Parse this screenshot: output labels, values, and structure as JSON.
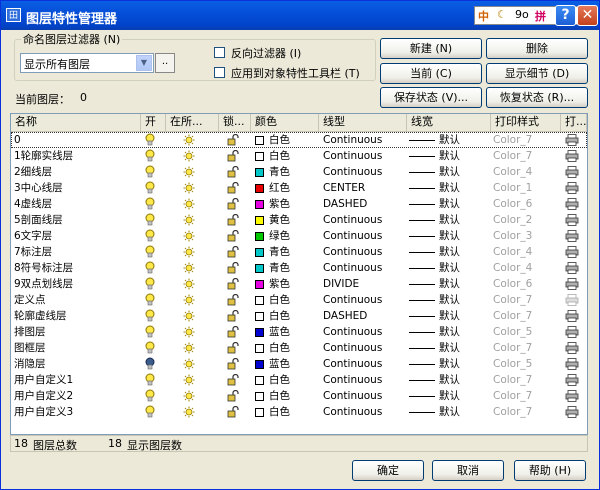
{
  "window": {
    "title": "图层特性管理器",
    "icon_label": "田",
    "ime": {
      "lang": "中",
      "items": [
        "☾",
        "9o",
        "拼"
      ]
    },
    "help_label": "?",
    "close_label": "✕"
  },
  "filter": {
    "legend": "命名图层过滤器 (N)",
    "selected": "显示所有图层",
    "dots_label": "..",
    "invert_label": "反向过滤器 (I)",
    "apply_label": "应用到对象特性工具栏 (T)"
  },
  "buttons": {
    "new": "新建 (N)",
    "delete": "删除",
    "current": "当前 (C)",
    "show_details": "显示细节 (D)",
    "save_state": "保存状态 (V)...",
    "restore_state": "恢复状态 (R)...",
    "ok": "确定",
    "cancel": "取消",
    "help": "帮助 (H)"
  },
  "current_layer": {
    "label": "当前图层：",
    "value": "0"
  },
  "columns": [
    "名称",
    "开",
    "在所...",
    "锁...",
    "颜色",
    "线型",
    "线宽",
    "打印样式",
    "打..."
  ],
  "layers": [
    {
      "name": "0",
      "on": true,
      "color_name": "白色",
      "color_hex": "#ffffff",
      "linetype": "Continuous",
      "lineweight": "默认",
      "plot_style": "Color_7",
      "selected": true
    },
    {
      "name": "1轮廓实线层",
      "on": true,
      "color_name": "白色",
      "color_hex": "#ffffff",
      "linetype": "Continuous",
      "lineweight": "默认",
      "plot_style": "Color_7"
    },
    {
      "name": "2细线层",
      "on": true,
      "color_name": "青色",
      "color_hex": "#00c8c8",
      "linetype": "Continuous",
      "lineweight": "默认",
      "plot_style": "Color_4"
    },
    {
      "name": "3中心线层",
      "on": true,
      "color_name": "红色",
      "color_hex": "#e60000",
      "linetype": "CENTER",
      "lineweight": "默认",
      "plot_style": "Color_1"
    },
    {
      "name": "4虚线层",
      "on": true,
      "color_name": "紫色",
      "color_hex": "#e600e6",
      "linetype": "DASHED",
      "lineweight": "默认",
      "plot_style": "Color_6"
    },
    {
      "name": "5剖面线层",
      "on": true,
      "color_name": "黄色",
      "color_hex": "#ffff00",
      "linetype": "Continuous",
      "lineweight": "默认",
      "plot_style": "Color_2"
    },
    {
      "name": "6文字层",
      "on": true,
      "color_name": "绿色",
      "color_hex": "#00c800",
      "linetype": "Continuous",
      "lineweight": "默认",
      "plot_style": "Color_3"
    },
    {
      "name": "7标注层",
      "on": true,
      "color_name": "青色",
      "color_hex": "#00c8c8",
      "linetype": "Continuous",
      "lineweight": "默认",
      "plot_style": "Color_4"
    },
    {
      "name": "8符号标注层",
      "on": true,
      "color_name": "青色",
      "color_hex": "#00c8c8",
      "linetype": "Continuous",
      "lineweight": "默认",
      "plot_style": "Color_4"
    },
    {
      "name": "9双点划线层",
      "on": true,
      "color_name": "紫色",
      "color_hex": "#e600e6",
      "linetype": "DIVIDE",
      "lineweight": "默认",
      "plot_style": "Color_6"
    },
    {
      "name": "定义点",
      "on": true,
      "color_name": "白色",
      "color_hex": "#ffffff",
      "linetype": "Continuous",
      "lineweight": "默认",
      "plot_style": "Color_7",
      "plot_disabled": true
    },
    {
      "name": "轮廓虚线层",
      "on": true,
      "color_name": "白色",
      "color_hex": "#ffffff",
      "linetype": "DASHED",
      "lineweight": "默认",
      "plot_style": "Color_7"
    },
    {
      "name": "排图层",
      "on": true,
      "color_name": "蓝色",
      "color_hex": "#0000d0",
      "linetype": "Continuous",
      "lineweight": "默认",
      "plot_style": "Color_5"
    },
    {
      "name": "图框层",
      "on": true,
      "color_name": "白色",
      "color_hex": "#ffffff",
      "linetype": "Continuous",
      "lineweight": "默认",
      "plot_style": "Color_7"
    },
    {
      "name": "消隐层",
      "on": false,
      "color_name": "蓝色",
      "color_hex": "#0000d0",
      "linetype": "Continuous",
      "lineweight": "默认",
      "plot_style": "Color_5"
    },
    {
      "name": "用户自定义1",
      "on": true,
      "color_name": "白色",
      "color_hex": "#ffffff",
      "linetype": "Continuous",
      "lineweight": "默认",
      "plot_style": "Color_7"
    },
    {
      "name": "用户自定义2",
      "on": true,
      "color_name": "白色",
      "color_hex": "#ffffff",
      "linetype": "Continuous",
      "lineweight": "默认",
      "plot_style": "Color_7"
    },
    {
      "name": "用户自定义3",
      "on": true,
      "color_name": "白色",
      "color_hex": "#ffffff",
      "linetype": "Continuous",
      "lineweight": "默认",
      "plot_style": "Color_7"
    }
  ],
  "status": {
    "total_count": "18",
    "total_label": "图层总数",
    "shown_count": "18",
    "shown_label": "显示图层数"
  }
}
